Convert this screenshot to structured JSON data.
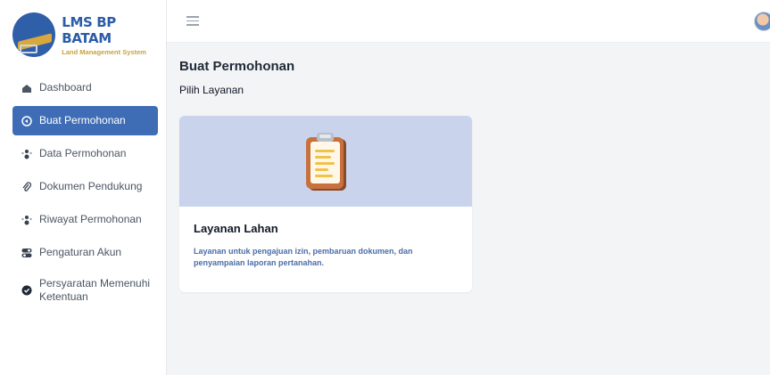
{
  "brand": {
    "title": "LMS BP BATAM",
    "subtitle": "Land Management System"
  },
  "sidebar": {
    "items": [
      {
        "label": "Dashboard",
        "icon": "home-icon",
        "active": false
      },
      {
        "label": "Buat Permohonan",
        "icon": "form-icon",
        "active": true
      },
      {
        "label": "Data Permohonan",
        "icon": "people-icon",
        "active": false
      },
      {
        "label": "Dokumen Pendukung",
        "icon": "paperclip-icon",
        "active": false
      },
      {
        "label": "Riwayat Permohonan",
        "icon": "people-icon",
        "active": false
      },
      {
        "label": "Pengaturan Akun",
        "icon": "toggle-icon",
        "active": false
      },
      {
        "label": "Persyaratan Memenuhi Ketentuan",
        "icon": "check-circle-icon",
        "active": false
      }
    ]
  },
  "header": {
    "menu_icon": "hamburger-icon",
    "avatar_icon": "user-avatar"
  },
  "main": {
    "title": "Buat Permohonan",
    "subtitle": "Pilih Layanan",
    "services": [
      {
        "title": "Layanan Lahan",
        "description": "Layanan untuk pengajuan izin, pembaruan dokumen, dan penyampaian laporan pertanahan.",
        "icon": "clipboard-icon"
      }
    ]
  },
  "colors": {
    "brand_blue": "#2b5ca8",
    "brand_gold": "#c9a23a",
    "active_nav": "#3f6db5",
    "card_banner": "#c9d4ec",
    "background": "#f3f4f6"
  }
}
